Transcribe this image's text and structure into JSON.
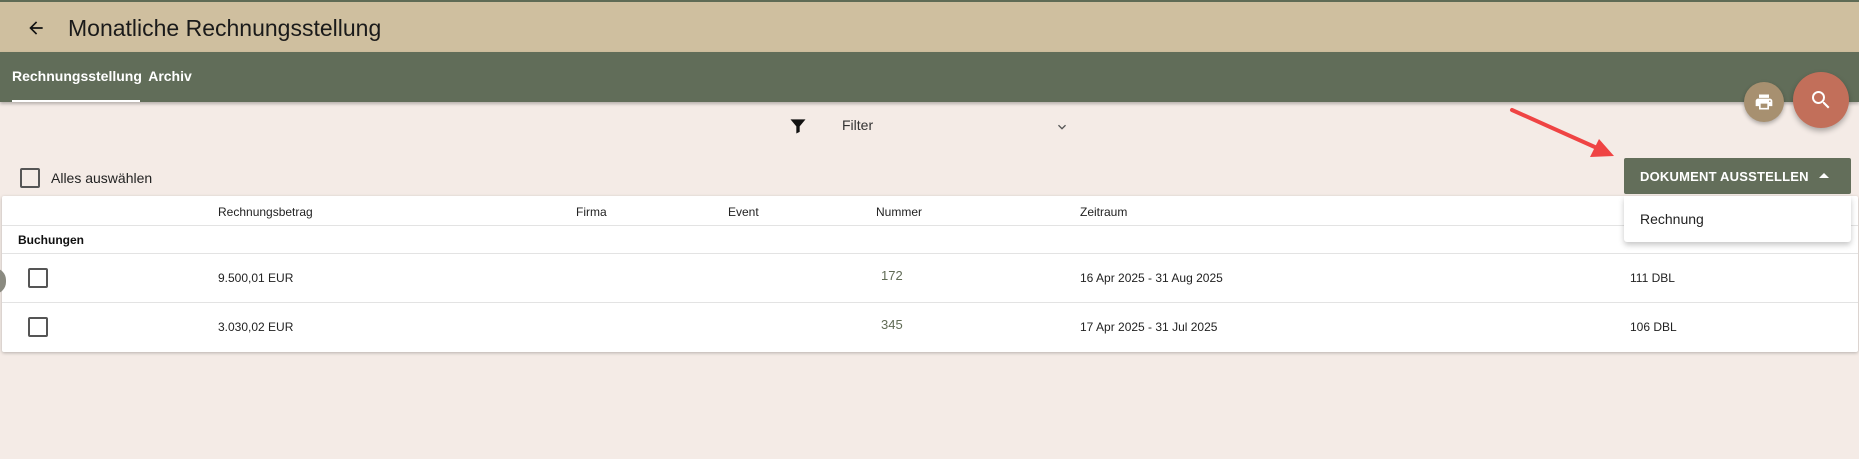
{
  "header": {
    "title": "Monatliche Rechnungsstellung",
    "back_icon": "arrow-left-icon"
  },
  "tabs": [
    {
      "label": "Rechnungsstellung",
      "active": true
    },
    {
      "label": "Archiv",
      "active": false
    }
  ],
  "fabs": {
    "print_icon": "printer-icon",
    "search_icon": "search-icon"
  },
  "filter": {
    "icon": "funnel-icon",
    "label": "Filter",
    "chevron": "chevron-down-icon"
  },
  "select_all": {
    "label": "Alles auswählen",
    "checked": false
  },
  "table": {
    "columns": [
      "Rechnungsbetrag",
      "Firma",
      "Event",
      "Nummer",
      "Zeitraum"
    ],
    "group": "Buchungen",
    "rows": [
      {
        "betrag": "9.500,01 EUR",
        "firma": "",
        "event": "",
        "nummer": "172",
        "zeitraum": "16 Apr 2025 - 31 Aug 2025",
        "extra": "111 DBL",
        "checked": false
      },
      {
        "betrag": "3.030,02 EUR",
        "firma": "",
        "event": "",
        "nummer": "345",
        "zeitraum": "17 Apr 2025 - 31 Jul 2025",
        "extra": "106 DBL",
        "checked": false
      }
    ]
  },
  "document_menu": {
    "button_label": "DOKUMENT AUSSTELLEN",
    "items": [
      "Rechnung"
    ]
  },
  "colors": {
    "background": "#f4ebe6",
    "header": "#cfbf9f",
    "tabbar": "#616d59",
    "print_fab": "#a79070",
    "search_fab": "#c26f5a",
    "annotation_arrow": "#ef4444"
  }
}
